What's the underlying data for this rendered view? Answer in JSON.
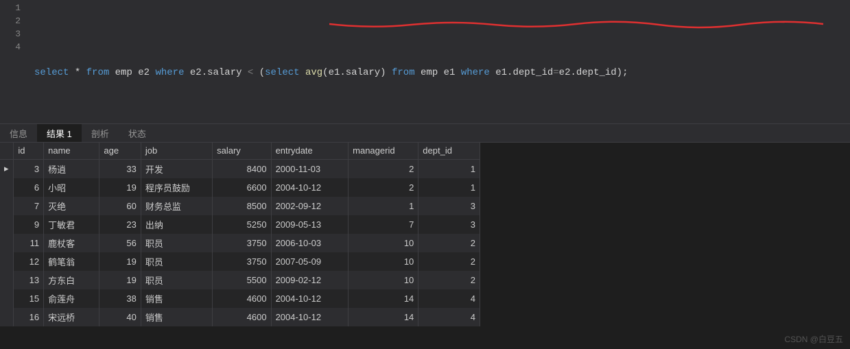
{
  "editor": {
    "lines": [
      "1",
      "2",
      "3",
      "4"
    ],
    "sql": {
      "tokens": [
        {
          "t": "select",
          "c": "kw"
        },
        {
          "t": " * ",
          "c": "op"
        },
        {
          "t": "from",
          "c": "kw"
        },
        {
          "t": " emp e2 ",
          "c": "txt"
        },
        {
          "t": "where",
          "c": "kw"
        },
        {
          "t": " e2.salary ",
          "c": "txt"
        },
        {
          "t": "<",
          "c": "gray"
        },
        {
          "t": " (",
          "c": "txt"
        },
        {
          "t": "select",
          "c": "kw"
        },
        {
          "t": " ",
          "c": "txt"
        },
        {
          "t": "avg",
          "c": "fn"
        },
        {
          "t": "(e1.salary) ",
          "c": "txt"
        },
        {
          "t": "from",
          "c": "kw"
        },
        {
          "t": " emp e1 ",
          "c": "txt"
        },
        {
          "t": "where",
          "c": "kw"
        },
        {
          "t": " e1.dept_id",
          "c": "txt"
        },
        {
          "t": "=",
          "c": "gray"
        },
        {
          "t": "e2.dept_id);",
          "c": "txt"
        }
      ]
    }
  },
  "tabs": {
    "items": [
      {
        "label": "信息",
        "active": false
      },
      {
        "label": "结果 1",
        "active": true
      },
      {
        "label": "剖析",
        "active": false
      },
      {
        "label": "状态",
        "active": false
      }
    ]
  },
  "table": {
    "headers": [
      "id",
      "name",
      "age",
      "job",
      "salary",
      "entrydate",
      "managerid",
      "dept_id"
    ],
    "rows": [
      {
        "id": 3,
        "name": "杨逍",
        "age": 33,
        "job": "开发",
        "salary": 8400,
        "entrydate": "2000-11-03",
        "managerid": 2,
        "dept_id": 1
      },
      {
        "id": 6,
        "name": "小昭",
        "age": 19,
        "job": "程序员鼓励",
        "salary": 6600,
        "entrydate": "2004-10-12",
        "managerid": 2,
        "dept_id": 1
      },
      {
        "id": 7,
        "name": "灭绝",
        "age": 60,
        "job": "财务总监",
        "salary": 8500,
        "entrydate": "2002-09-12",
        "managerid": 1,
        "dept_id": 3
      },
      {
        "id": 9,
        "name": "丁敏君",
        "age": 23,
        "job": "出纳",
        "salary": 5250,
        "entrydate": "2009-05-13",
        "managerid": 7,
        "dept_id": 3
      },
      {
        "id": 11,
        "name": "鹿杖客",
        "age": 56,
        "job": "职员",
        "salary": 3750,
        "entrydate": "2006-10-03",
        "managerid": 10,
        "dept_id": 2
      },
      {
        "id": 12,
        "name": "鹤笔翁",
        "age": 19,
        "job": "职员",
        "salary": 3750,
        "entrydate": "2007-05-09",
        "managerid": 10,
        "dept_id": 2
      },
      {
        "id": 13,
        "name": "方东白",
        "age": 19,
        "job": "职员",
        "salary": 5500,
        "entrydate": "2009-02-12",
        "managerid": 10,
        "dept_id": 2
      },
      {
        "id": 15,
        "name": "俞莲舟",
        "age": 38,
        "job": "销售",
        "salary": 4600,
        "entrydate": "2004-10-12",
        "managerid": 14,
        "dept_id": 4
      },
      {
        "id": 16,
        "name": "宋远桥",
        "age": 40,
        "job": "销售",
        "salary": 4600,
        "entrydate": "2004-10-12",
        "managerid": 14,
        "dept_id": 4
      }
    ]
  },
  "watermark": "CSDN @白豆五"
}
